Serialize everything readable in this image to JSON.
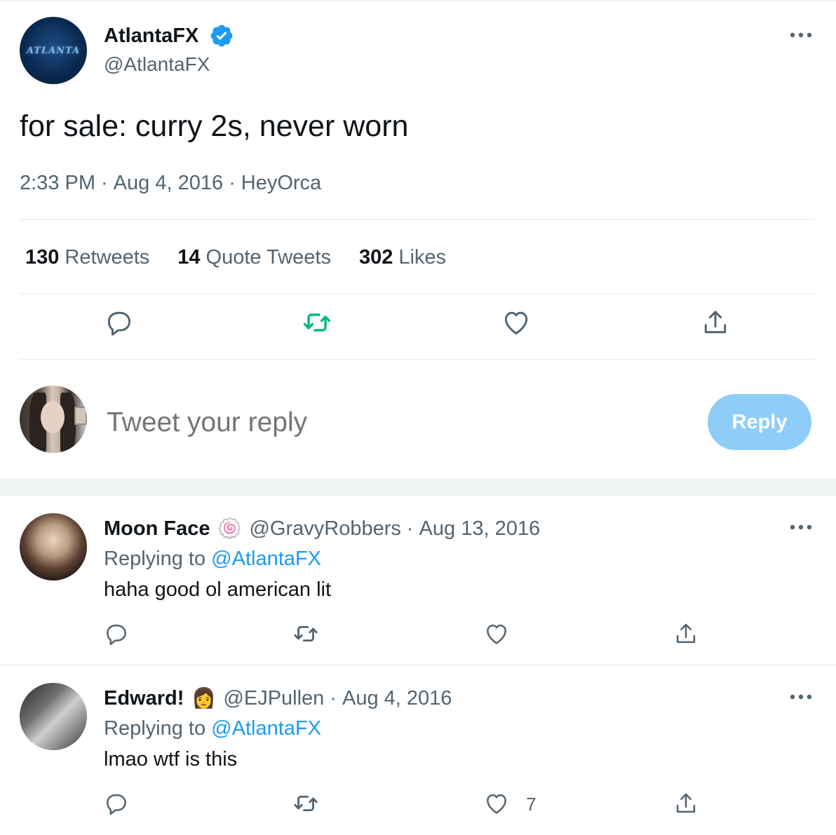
{
  "main_tweet": {
    "avatar_logo_text": "ATLANTA",
    "display_name": "AtlantaFX",
    "handle": "@AtlantaFX",
    "verified_icon": "verified-badge-icon",
    "text": "for sale: curry 2s, never worn",
    "time": "2:33 PM",
    "date": "Aug 4, 2016",
    "source": "HeyOrca",
    "meta_separator": "·",
    "stats": {
      "retweets_count": "130",
      "retweets_label": "Retweets",
      "quotes_count": "14",
      "quotes_label": "Quote Tweets",
      "likes_count": "302",
      "likes_label": "Likes"
    },
    "actions": [
      "reply-icon",
      "retweet-icon",
      "like-icon",
      "share-icon"
    ]
  },
  "composer": {
    "placeholder": "Tweet your reply",
    "button_label": "Reply"
  },
  "replies": [
    {
      "display_name": "Moon Face",
      "badge": "🍥",
      "handle": "@GravyRobbers",
      "date": "Aug 13, 2016",
      "replying_prefix": "Replying to",
      "replying_mention": "@AtlantaFX",
      "text": "haha good ol american lit",
      "like_count": ""
    },
    {
      "display_name": "Edward!",
      "badge": "👩",
      "handle": "@EJPullen",
      "date": "Aug 4, 2016",
      "replying_prefix": "Replying to",
      "replying_mention": "@AtlantaFX",
      "text": "lmao wtf is this",
      "like_count": "7"
    }
  ],
  "colors": {
    "accent": "#1d9bf0",
    "retweet_active": "#00ba7c",
    "reply_button_disabled": "#8ecdf8",
    "secondary_text": "#536471",
    "separator": "#eff3f4"
  }
}
